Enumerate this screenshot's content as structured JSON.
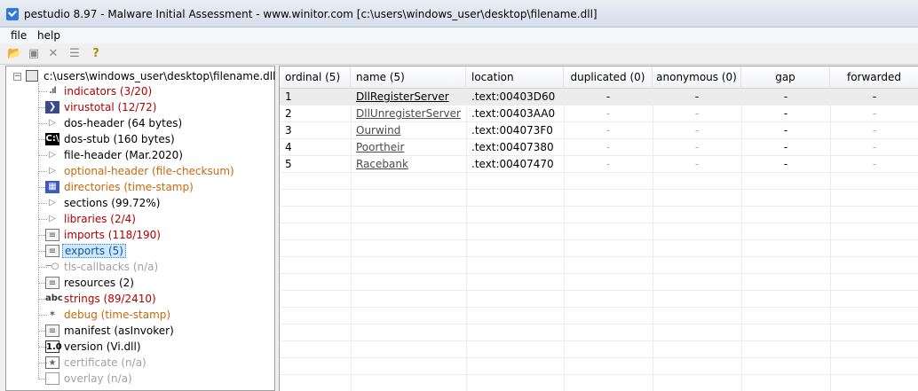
{
  "window": {
    "title": "pestudio 8.97 - Malware Initial Assessment - www.winitor.com [c:\\users\\windows_user\\desktop\\filename.dll]",
    "icon": "pestudio-check-icon",
    "accent": "#2e7bd6"
  },
  "menu": {
    "file": "file",
    "help": "help"
  },
  "toolbar": [
    "open-icon",
    "save-icon",
    "close-icon",
    "list-icon",
    "help-icon"
  ],
  "tree": {
    "root": "c:\\users\\windows_user\\desktop\\filename.dll",
    "items": [
      {
        "label": "indicators (3/20)",
        "color": "red",
        "icon": "bar-chart-icon"
      },
      {
        "label": "virustotal (12/72)",
        "color": "red",
        "icon": "virustotal-icon"
      },
      {
        "label": "dos-header (64 bytes)",
        "color": "black",
        "icon": "triangle-icon"
      },
      {
        "label": "dos-stub (160 bytes)",
        "color": "black",
        "icon": "console-icon"
      },
      {
        "label": "file-header (Mar.2020)",
        "color": "black",
        "icon": "triangle-icon"
      },
      {
        "label": "optional-header (file-checksum)",
        "color": "orange",
        "icon": "triangle-icon"
      },
      {
        "label": "directories (time-stamp)",
        "color": "orange",
        "icon": "directory-icon"
      },
      {
        "label": "sections (99.72%)",
        "color": "black",
        "icon": "triangle-icon"
      },
      {
        "label": "libraries (2/4)",
        "color": "red",
        "icon": "triangle-icon"
      },
      {
        "label": "imports (118/190)",
        "color": "red",
        "icon": "document-icon"
      },
      {
        "label": "exports (5)",
        "color": "black",
        "icon": "document-icon",
        "selected": true
      },
      {
        "label": "tls-callbacks (n/a)",
        "color": "grey",
        "icon": "key-icon"
      },
      {
        "label": "resources (2)",
        "color": "black",
        "icon": "document-icon"
      },
      {
        "label": "strings (89/2410)",
        "color": "red",
        "icon": "abc-icon"
      },
      {
        "label": "debug (time-stamp)",
        "color": "orange",
        "icon": "bug-icon"
      },
      {
        "label": "manifest (asInvoker)",
        "color": "black",
        "icon": "document-icon"
      },
      {
        "label": "version (Vi.dll)",
        "color": "black",
        "icon": "version-icon"
      },
      {
        "label": "certificate (n/a)",
        "color": "grey",
        "icon": "certificate-icon"
      },
      {
        "label": "overlay (n/a)",
        "color": "grey",
        "icon": "page-icon"
      }
    ]
  },
  "table": {
    "headers": {
      "ordinal": "ordinal (5)",
      "name": "name (5)",
      "location": "location",
      "duplicated": "duplicated (0)",
      "anonymous": "anonymous (0)",
      "gap": "gap",
      "forwarded": "forwarded"
    },
    "rows": [
      {
        "ordinal": "1",
        "name": "DllRegisterServer",
        "location": ".text:00403D60",
        "duplicated": "-",
        "anonymous": "-",
        "gap": "-",
        "forwarded": "-"
      },
      {
        "ordinal": "2",
        "name": "DllUnregisterServer",
        "location": ".text:00403AA0",
        "duplicated": "-",
        "anonymous": "-",
        "gap": "-",
        "forwarded": "-"
      },
      {
        "ordinal": "3",
        "name": "Ourwind",
        "location": ".text:004073F0",
        "duplicated": "-",
        "anonymous": "-",
        "gap": "-",
        "forwarded": "-"
      },
      {
        "ordinal": "4",
        "name": "Poortheir",
        "location": ".text:00407380",
        "duplicated": "-",
        "anonymous": "-",
        "gap": "-",
        "forwarded": "-"
      },
      {
        "ordinal": "5",
        "name": "Racebank",
        "location": ".text:00407470",
        "duplicated": "-",
        "anonymous": "-",
        "gap": "-",
        "forwarded": "-"
      }
    ]
  }
}
